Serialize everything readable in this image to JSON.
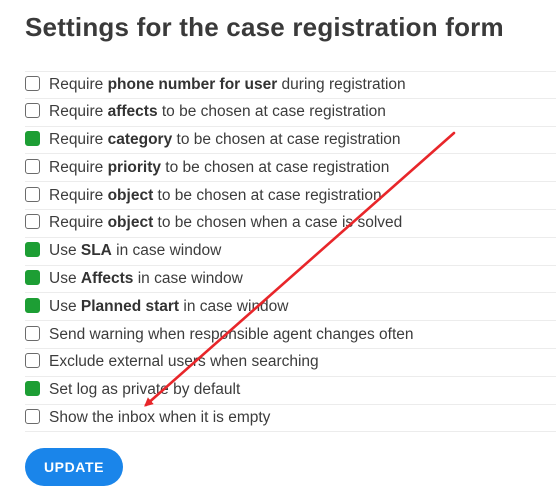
{
  "page": {
    "title": "Settings for the case registration form"
  },
  "settings": [
    {
      "pre": "Require ",
      "bold": "phone number for user",
      "post": " during registration",
      "checked": false
    },
    {
      "pre": "Require ",
      "bold": "affects",
      "post": " to be chosen at case registration",
      "checked": false
    },
    {
      "pre": "Require ",
      "bold": "category",
      "post": " to be chosen at case registration",
      "checked": true
    },
    {
      "pre": "Require ",
      "bold": "priority",
      "post": " to be chosen at case registration",
      "checked": false
    },
    {
      "pre": "Require ",
      "bold": "object",
      "post": " to be chosen at case registration",
      "checked": false
    },
    {
      "pre": "Require ",
      "bold": "object",
      "post": " to be chosen when a case is solved",
      "checked": false
    },
    {
      "pre": "Use ",
      "bold": "SLA",
      "post": " in case window",
      "checked": true
    },
    {
      "pre": "Use ",
      "bold": "Affects",
      "post": " in case window",
      "checked": true
    },
    {
      "pre": "Use ",
      "bold": "Planned start",
      "post": " in case window",
      "checked": true
    },
    {
      "pre": "Send warning when responsible agent changes often",
      "bold": "",
      "post": "",
      "checked": false
    },
    {
      "pre": "Exclude external users when searching",
      "bold": "",
      "post": "",
      "checked": false
    },
    {
      "pre": "Set log as private by default",
      "bold": "",
      "post": "",
      "checked": true
    },
    {
      "pre": "Show the inbox when it is empty",
      "bold": "",
      "post": "",
      "checked": false
    }
  ],
  "actions": {
    "update_label": "UPDATE"
  },
  "colors": {
    "checked": "#1d9e34",
    "unchecked_border": "#6b6b6b",
    "button": "#1a85ea",
    "annotation_arrow": "#e8262a"
  },
  "icons": {
    "annotation": "red-arrow-icon"
  }
}
